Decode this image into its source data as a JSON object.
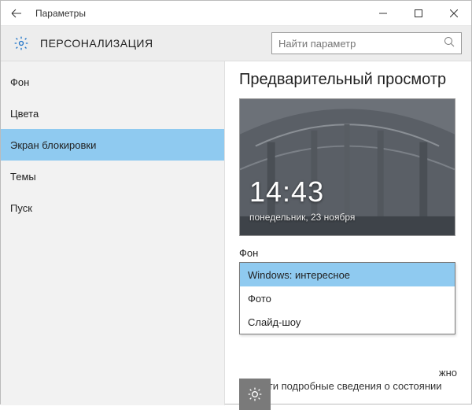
{
  "window": {
    "title": "Параметры"
  },
  "header": {
    "title": "ПЕРСОНАЛИЗАЦИЯ",
    "search_placeholder": "Найти параметр"
  },
  "sidebar": {
    "items": [
      {
        "label": "Фон"
      },
      {
        "label": "Цвета"
      },
      {
        "label": "Экран блокировки"
      },
      {
        "label": "Темы"
      },
      {
        "label": "Пуск"
      }
    ],
    "active_index": 2
  },
  "content": {
    "preview_title": "Предварительный просмотр",
    "clock": "14:43",
    "date": "понедельник, 23 ноября",
    "bg_label": "Фон",
    "options": [
      {
        "label": "Windows: интересное"
      },
      {
        "label": "Фото"
      },
      {
        "label": "Слайд-шоу"
      }
    ],
    "selected_option": 0,
    "hidden_line_tail": "жно",
    "hidden_line2": "вывести подробные сведения о состоянии"
  }
}
